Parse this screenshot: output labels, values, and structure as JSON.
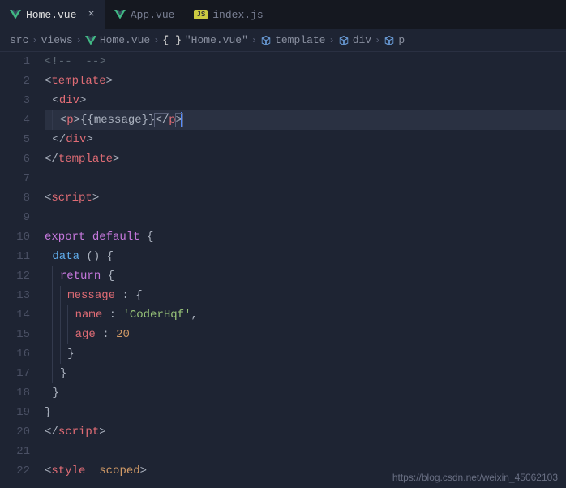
{
  "tabs": [
    {
      "label": "Home.vue",
      "type": "vue",
      "active": true
    },
    {
      "label": "App.vue",
      "type": "vue",
      "active": false
    },
    {
      "label": "index.js",
      "type": "js",
      "active": false
    }
  ],
  "breadcrumb": {
    "items": [
      "src",
      "views",
      "Home.vue",
      "\"Home.vue\"",
      "template",
      "div",
      "p"
    ]
  },
  "gutter": {
    "start": 1,
    "end": 22
  },
  "code_tokens": {
    "l1": {
      "comment_open": "<!--",
      "comment_close": "-->"
    },
    "l2": {
      "open": "<",
      "tag": "template",
      "close": ">"
    },
    "l3": {
      "open": "<",
      "tag": "div",
      "close": ">"
    },
    "l4": {
      "open": "<",
      "tag_p": "p",
      "close": ">",
      "expr": "{{message}}",
      "open2": "</",
      "close2": ">"
    },
    "l5": {
      "open": "</",
      "tag": "div",
      "close": ">"
    },
    "l6": {
      "open": "</",
      "tag": "template",
      "close": ">"
    },
    "l8": {
      "open": "<",
      "tag": "script",
      "close": ">"
    },
    "l10": {
      "kw1": "export",
      "kw2": "default",
      "brace": "{"
    },
    "l11": {
      "func": "data",
      "parens": "()",
      "brace": "{"
    },
    "l12": {
      "kw": "return",
      "brace": "{"
    },
    "l13": {
      "prop": "message",
      "colon": ":",
      "brace": "{"
    },
    "l14": {
      "prop": "name",
      "colon": ":",
      "str": "'CoderHqf'",
      "comma": ","
    },
    "l15": {
      "prop": "age",
      "colon": ":",
      "num": "20"
    },
    "l16": {
      "brace": "}"
    },
    "l17": {
      "brace": "}"
    },
    "l18": {
      "brace": "}"
    },
    "l19": {
      "brace": "}"
    },
    "l20": {
      "open": "</",
      "tag": "script",
      "close": ">"
    },
    "l22": {
      "open": "<",
      "tag": "style",
      "attr": "scoped",
      "close": ">"
    }
  },
  "watermark": "https://blog.csdn.net/weixin_45062103"
}
